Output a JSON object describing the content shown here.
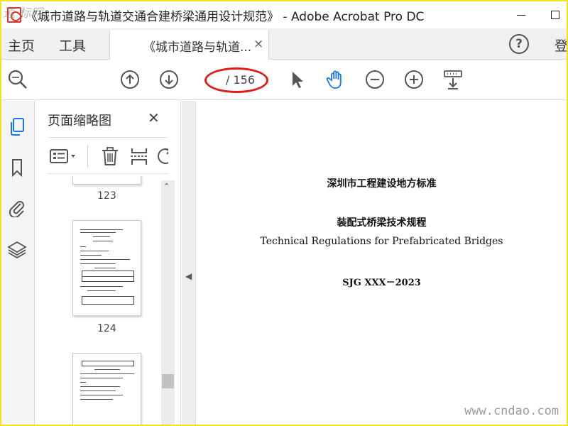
{
  "window": {
    "title": "《城市道路与轨道交通合建桥梁通用设计规范》 - Adobe Acrobat Pro DC"
  },
  "menubar": {
    "home": "主页",
    "tools": "工具",
    "doc_tab_label": "《城市道路与轨道...",
    "doc_tab_close": "×",
    "signin": "登"
  },
  "toolbar": {
    "page_current": "",
    "page_total": "/ 156",
    "icons": [
      "search-zoom-icon",
      "prev-page-icon",
      "next-page-icon",
      "select-cursor-icon",
      "hand-tool-icon",
      "zoom-out-icon",
      "zoom-in-icon",
      "scroll-mode-icon"
    ]
  },
  "left_rail": {
    "icons": [
      "page-thumbnails-icon",
      "bookmark-icon",
      "attachment-icon",
      "layers-icon"
    ]
  },
  "thumb_panel": {
    "title": "页面缩略图",
    "close": "✕",
    "thumbnails": [
      {
        "label": "123"
      },
      {
        "label": "124"
      },
      {
        "label": ""
      }
    ]
  },
  "document": {
    "line1": "深圳市工程建设地方标准",
    "line2": "装配式桥梁技术规程",
    "line3": "Technical Regulations for Prefabricated Bridges",
    "line4": "SJG XXX－2023"
  },
  "watermark": {
    "url": "www.cndao.com",
    "corner": "道 标网"
  },
  "colors": {
    "frame": "#f2e51c",
    "annotation": "#e01c1c",
    "hand_tool_active": "#1a73e8"
  }
}
